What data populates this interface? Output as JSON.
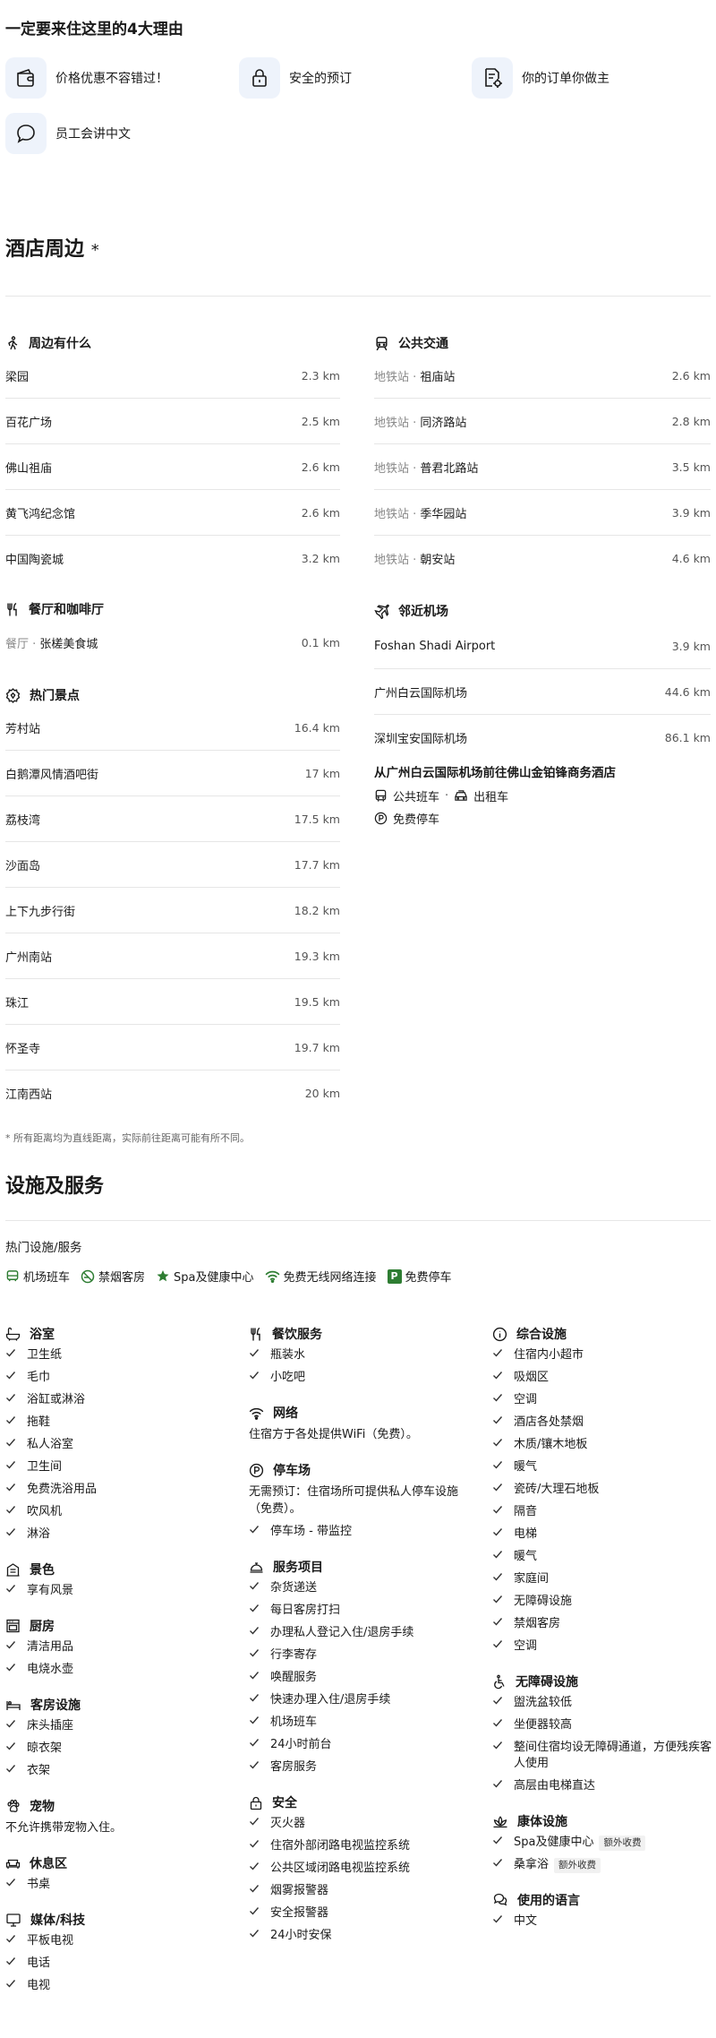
{
  "reasons": {
    "title": "一定要来住这里的4大理由",
    "items": [
      {
        "label": "价格优惠不容错过！",
        "icon": "wallet-icon"
      },
      {
        "label": "安全的预订",
        "icon": "lock-icon"
      },
      {
        "label": "你的订单你做主",
        "icon": "document-settings-icon"
      },
      {
        "label": "员工会讲中文",
        "icon": "chat-bubble-icon"
      }
    ]
  },
  "nearby": {
    "title": "酒店周边",
    "title_mark": "*",
    "what_nearby": {
      "label": "周边有什么",
      "rows": [
        {
          "name": "梁园",
          "dist": "2.3 km"
        },
        {
          "name": "百花广场",
          "dist": "2.5 km"
        },
        {
          "name": "佛山祖庙",
          "dist": "2.6 km"
        },
        {
          "name": "黄飞鸿纪念馆",
          "dist": "2.6 km"
        },
        {
          "name": "中国陶瓷城",
          "dist": "3.2 km"
        }
      ]
    },
    "restaurants": {
      "label": "餐厅和咖啡厅",
      "rows": [
        {
          "prefix": "餐厅 · ",
          "name": "张槎美食城",
          "dist": "0.1 km"
        }
      ]
    },
    "attractions": {
      "label": "热门景点",
      "rows": [
        {
          "name": "芳村站",
          "dist": "16.4 km"
        },
        {
          "name": "白鹅潭风情酒吧街",
          "dist": "17 km"
        },
        {
          "name": "荔枝湾",
          "dist": "17.5 km"
        },
        {
          "name": "沙面岛",
          "dist": "17.7 km"
        },
        {
          "name": "上下九步行街",
          "dist": "18.2 km"
        },
        {
          "name": "广州南站",
          "dist": "19.3 km"
        },
        {
          "name": "珠江",
          "dist": "19.5 km"
        },
        {
          "name": "怀圣寺",
          "dist": "19.7 km"
        },
        {
          "name": "江南西站",
          "dist": "20 km"
        }
      ]
    },
    "transit": {
      "label": "公共交通",
      "rows": [
        {
          "prefix": "地铁站 · ",
          "name": "祖庙站",
          "dist": "2.6 km"
        },
        {
          "prefix": "地铁站 · ",
          "name": "同济路站",
          "dist": "2.8 km"
        },
        {
          "prefix": "地铁站 · ",
          "name": "普君北路站",
          "dist": "3.5 km"
        },
        {
          "prefix": "地铁站 · ",
          "name": "季华园站",
          "dist": "3.9 km"
        },
        {
          "prefix": "地铁站 · ",
          "name": "朝安站",
          "dist": "4.6 km"
        }
      ]
    },
    "airports": {
      "label": "邻近机场",
      "rows": [
        {
          "name": "Foshan Shadi Airport",
          "dist": "3.9 km"
        },
        {
          "name": "广州白云国际机场",
          "dist": "44.6 km"
        },
        {
          "name": "深圳宝安国际机场",
          "dist": "86.1 km"
        }
      ]
    },
    "transfer": {
      "title": "从广州白云国际机场前往佛山金铂锋商务酒店",
      "bus": "公共班车",
      "sep": "·",
      "taxi": "出租车",
      "parking": "免费停车"
    },
    "note": "* 所有距离均为直线距离，实际前往距离可能有所不同。"
  },
  "facilities": {
    "title": "设施及服务",
    "popular_label": "热门设施/服务",
    "popular": [
      {
        "label": "机场班车",
        "icon": "shuttle-icon"
      },
      {
        "label": "禁烟客房",
        "icon": "no-smoking-icon"
      },
      {
        "label": "Spa及健康中心",
        "icon": "spa-icon"
      },
      {
        "label": "免费无线网络连接",
        "icon": "wifi-icon"
      },
      {
        "label": "免费停车",
        "icon": "parking-icon",
        "badge": "P"
      }
    ],
    "bathroom": {
      "title": "浴室",
      "items": [
        "卫生纸",
        "毛巾",
        "浴缸或淋浴",
        "拖鞋",
        "私人浴室",
        "卫生间",
        "免费洗浴用品",
        "吹风机",
        "淋浴"
      ]
    },
    "view": {
      "title": "景色",
      "items": [
        "享有风景"
      ]
    },
    "kitchen": {
      "title": "厨房",
      "items": [
        "清洁用品",
        "电烧水壶"
      ]
    },
    "room": {
      "title": "客房设施",
      "items": [
        "床头插座",
        "晾衣架",
        "衣架"
      ]
    },
    "pets": {
      "title": "宠物",
      "desc": "不允许携带宠物入住。"
    },
    "lounge": {
      "title": "休息区",
      "items": [
        "书桌"
      ]
    },
    "media": {
      "title": "媒体/科技",
      "items": [
        "平板电视",
        "电话",
        "电视"
      ]
    },
    "dining": {
      "title": "餐饮服务",
      "items": [
        "瓶装水",
        "小吃吧"
      ]
    },
    "internet": {
      "title": "网络",
      "desc": "住宿方于各处提供WiFi（免费）。"
    },
    "parking": {
      "title": "停车场",
      "desc": "无需预订：住宿场所可提供私人停车设施（免费）。",
      "items": [
        "停车场 - 带监控"
      ]
    },
    "services": {
      "title": "服务项目",
      "items": [
        "杂货递送",
        "每日客房打扫",
        "办理私人登记入住/退房手续",
        "行李寄存",
        "唤醒服务",
        "快速办理入住/退房手续",
        "机场班车",
        "24小时前台",
        "客房服务"
      ]
    },
    "safety": {
      "title": "安全",
      "items": [
        "灭火器",
        "住宿外部闭路电视监控系统",
        "公共区域闭路电视监控系统",
        "烟雾报警器",
        "安全报警器",
        "24小时安保"
      ]
    },
    "general": {
      "title": "综合设施",
      "items": [
        "住宿内小超市",
        "吸烟区",
        "空调",
        "酒店各处禁烟",
        "木质/镶木地板",
        "暖气",
        "瓷砖/大理石地板",
        "隔音",
        "电梯",
        "暖气",
        "家庭间",
        "无障碍设施",
        "禁烟客房",
        "空调"
      ]
    },
    "accessibility": {
      "title": "无障碍设施",
      "items": [
        "盥洗盆较低",
        "坐便器较高",
        "整间住宿均设无障碍通道，方便残疾客人使用",
        "高层由电梯直达"
      ]
    },
    "wellness": {
      "title": "康体设施",
      "items": [
        {
          "label": "Spa及健康中心",
          "fee": "额外收费"
        },
        {
          "label": "桑拿浴",
          "fee": "额外收费"
        }
      ]
    },
    "languages": {
      "title": "使用的语言",
      "items": [
        "中文"
      ]
    }
  }
}
